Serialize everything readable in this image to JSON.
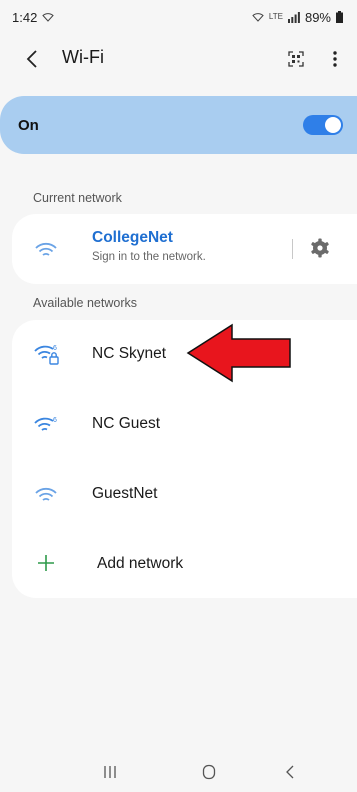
{
  "status_bar": {
    "time": "1:42",
    "battery_percent": "89%"
  },
  "app_bar": {
    "title": "Wi-Fi",
    "back_icon": "chevron-left-icon",
    "qr_icon": "qr-code-icon",
    "more_icon": "more-vertical-icon"
  },
  "toggle": {
    "label": "On",
    "enabled": true
  },
  "current_section": {
    "label": "Current network",
    "network": {
      "name": "CollegeNet",
      "status": "Sign in to the network.",
      "icon": "wifi-icon"
    }
  },
  "available_section": {
    "label": "Available networks",
    "networks": [
      {
        "name": "NC Skynet",
        "icon": "wifi-6-lock-icon",
        "secured": true
      },
      {
        "name": "NC Guest",
        "icon": "wifi-6-icon",
        "secured": false
      },
      {
        "name": "GuestNet",
        "icon": "wifi-icon",
        "secured": false
      }
    ],
    "add_label": "Add network"
  },
  "colors": {
    "accent": "#2f7fe8",
    "toggle_card": "#a9cdf0",
    "link_blue": "#1f6fd1",
    "add_green": "#2e9a4a",
    "arrow_red": "#e8151d"
  }
}
